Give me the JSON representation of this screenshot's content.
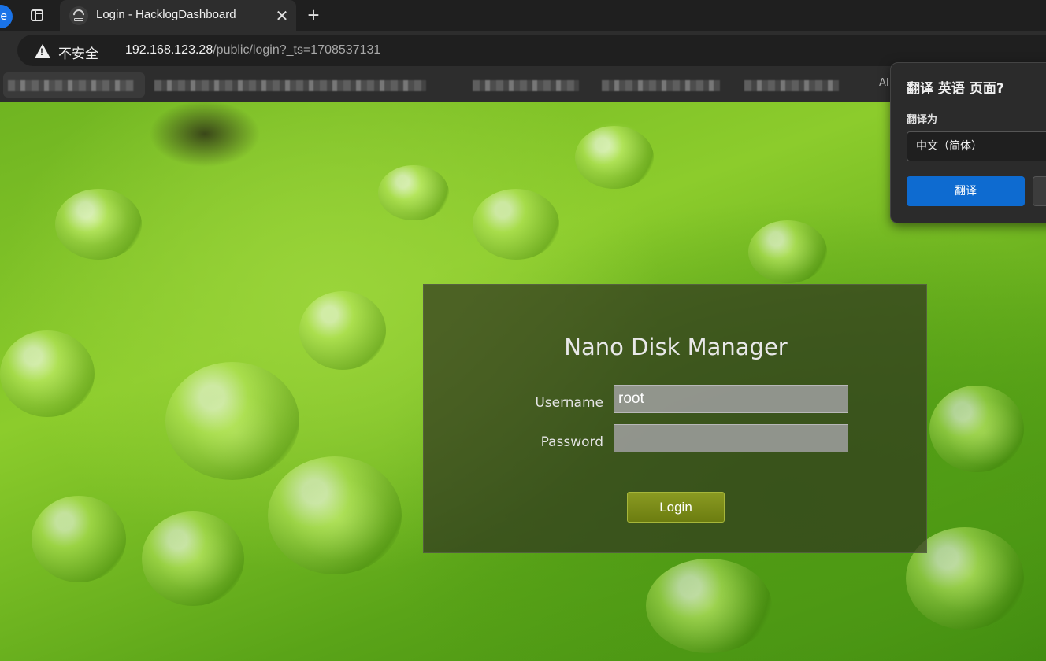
{
  "browser": {
    "profile_initial": "e",
    "tab": {
      "title": "Login - HacklogDashboard",
      "close_glyph": "✕"
    },
    "new_tab_glyph": "+",
    "address": {
      "security_label": "不安全",
      "url_host": "192.168.123.28",
      "url_path": "/public/login?_ts=1708537131"
    },
    "bookmarks_cut_text": "Al"
  },
  "login": {
    "title": "Nano Disk Manager",
    "username_label": "Username",
    "username_value": "root",
    "password_label": "Password",
    "password_value": "",
    "login_label": "Login"
  },
  "translate_popup": {
    "title": "翻译 英语 页面?",
    "target_label": "翻译为",
    "target_language": "中文（简体）",
    "translate_button": "翻译"
  },
  "colors": {
    "accent_blue": "#0e6bd0",
    "login_button": "#7a8b18",
    "page_green": "#6fb421"
  }
}
